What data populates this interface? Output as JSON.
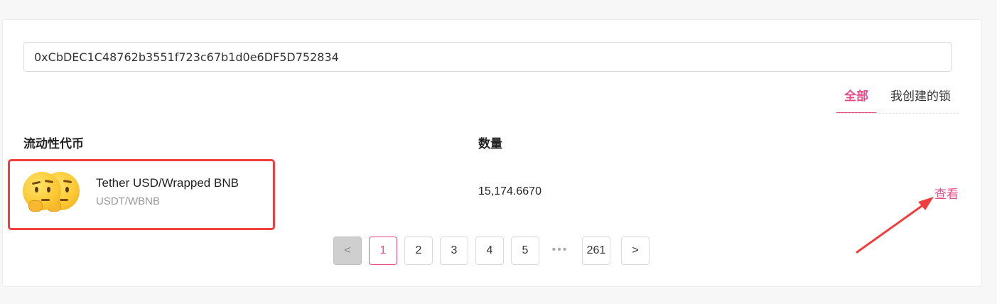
{
  "search": {
    "value": "0xCbDEC1C48762b3551f723c67b1d0e6DF5D752834"
  },
  "tabs": [
    {
      "label": "全部",
      "active": true
    },
    {
      "label": "我创建的锁",
      "active": false
    }
  ],
  "table": {
    "headers": {
      "token": "流动性代币",
      "amount": "数量"
    },
    "rows": [
      {
        "icon": "thinking-face-icon",
        "name": "Tether USD/Wrapped BNB",
        "symbol": "USDT/WBNB",
        "amount": "15,174.6670",
        "action": "查看"
      }
    ]
  },
  "pagination": {
    "prev": "<",
    "pages": [
      "1",
      "2",
      "3",
      "4",
      "5"
    ],
    "ellipsis": "•••",
    "last": "261",
    "next": ">",
    "current": "1"
  },
  "colors": {
    "accent": "#ea4c89",
    "annotation": "#f03e3e"
  }
}
